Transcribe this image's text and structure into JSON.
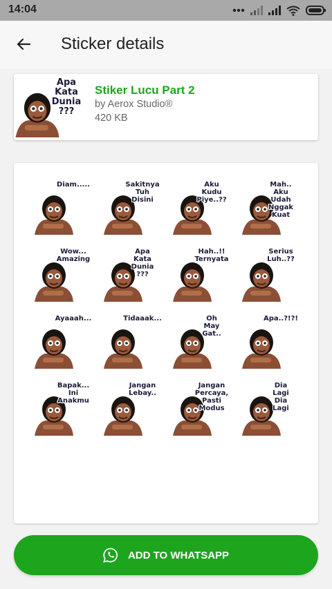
{
  "status_bar": {
    "time": "14:04",
    "icons": [
      "more-dots-icon",
      "signal-icon",
      "signal-icon",
      "wifi-icon",
      "battery-icon"
    ]
  },
  "app_bar": {
    "back_icon": "arrow-left-icon",
    "title": "Sticker details"
  },
  "pack": {
    "thumbnail_caption": "Apa\nKata\nDunia\n???",
    "name": "Stiker Lucu Part 2",
    "publisher": "by Aerox Studio®",
    "size": "420 KB"
  },
  "stickers": [
    {
      "caption": "Diam....."
    },
    {
      "caption": "Sakitnya\nTuh\nDisini"
    },
    {
      "caption": "Aku\nKudu\nPiye..??"
    },
    {
      "caption": "Mah..\nAku\nUdah\nNggak\nKuat"
    },
    {
      "caption": "Wow...\nAmazing"
    },
    {
      "caption": "Apa\nKata\nDunia\n???"
    },
    {
      "caption": "Hah..!!\nTernyata"
    },
    {
      "caption": "Serius\nLuh..??"
    },
    {
      "caption": "Ayaaah..."
    },
    {
      "caption": "Tidaaak..."
    },
    {
      "caption": "Oh\nMay\nGat.."
    },
    {
      "caption": "Apa..?!?!"
    },
    {
      "caption": "Bapak...\nIni\nAnakmu"
    },
    {
      "caption": "Jangan\nLebay.."
    },
    {
      "caption": "Jangan\nPercaya,\nPasti\nModus"
    },
    {
      "caption": "Dia\nLagi\nDia\nLagi"
    }
  ],
  "add_button": {
    "icon": "whatsapp-icon",
    "label": "ADD TO WHATSAPP"
  },
  "colors": {
    "accent": "#1ea51e",
    "status_bar": "#a9a9a9",
    "background": "#f2f2f2"
  }
}
